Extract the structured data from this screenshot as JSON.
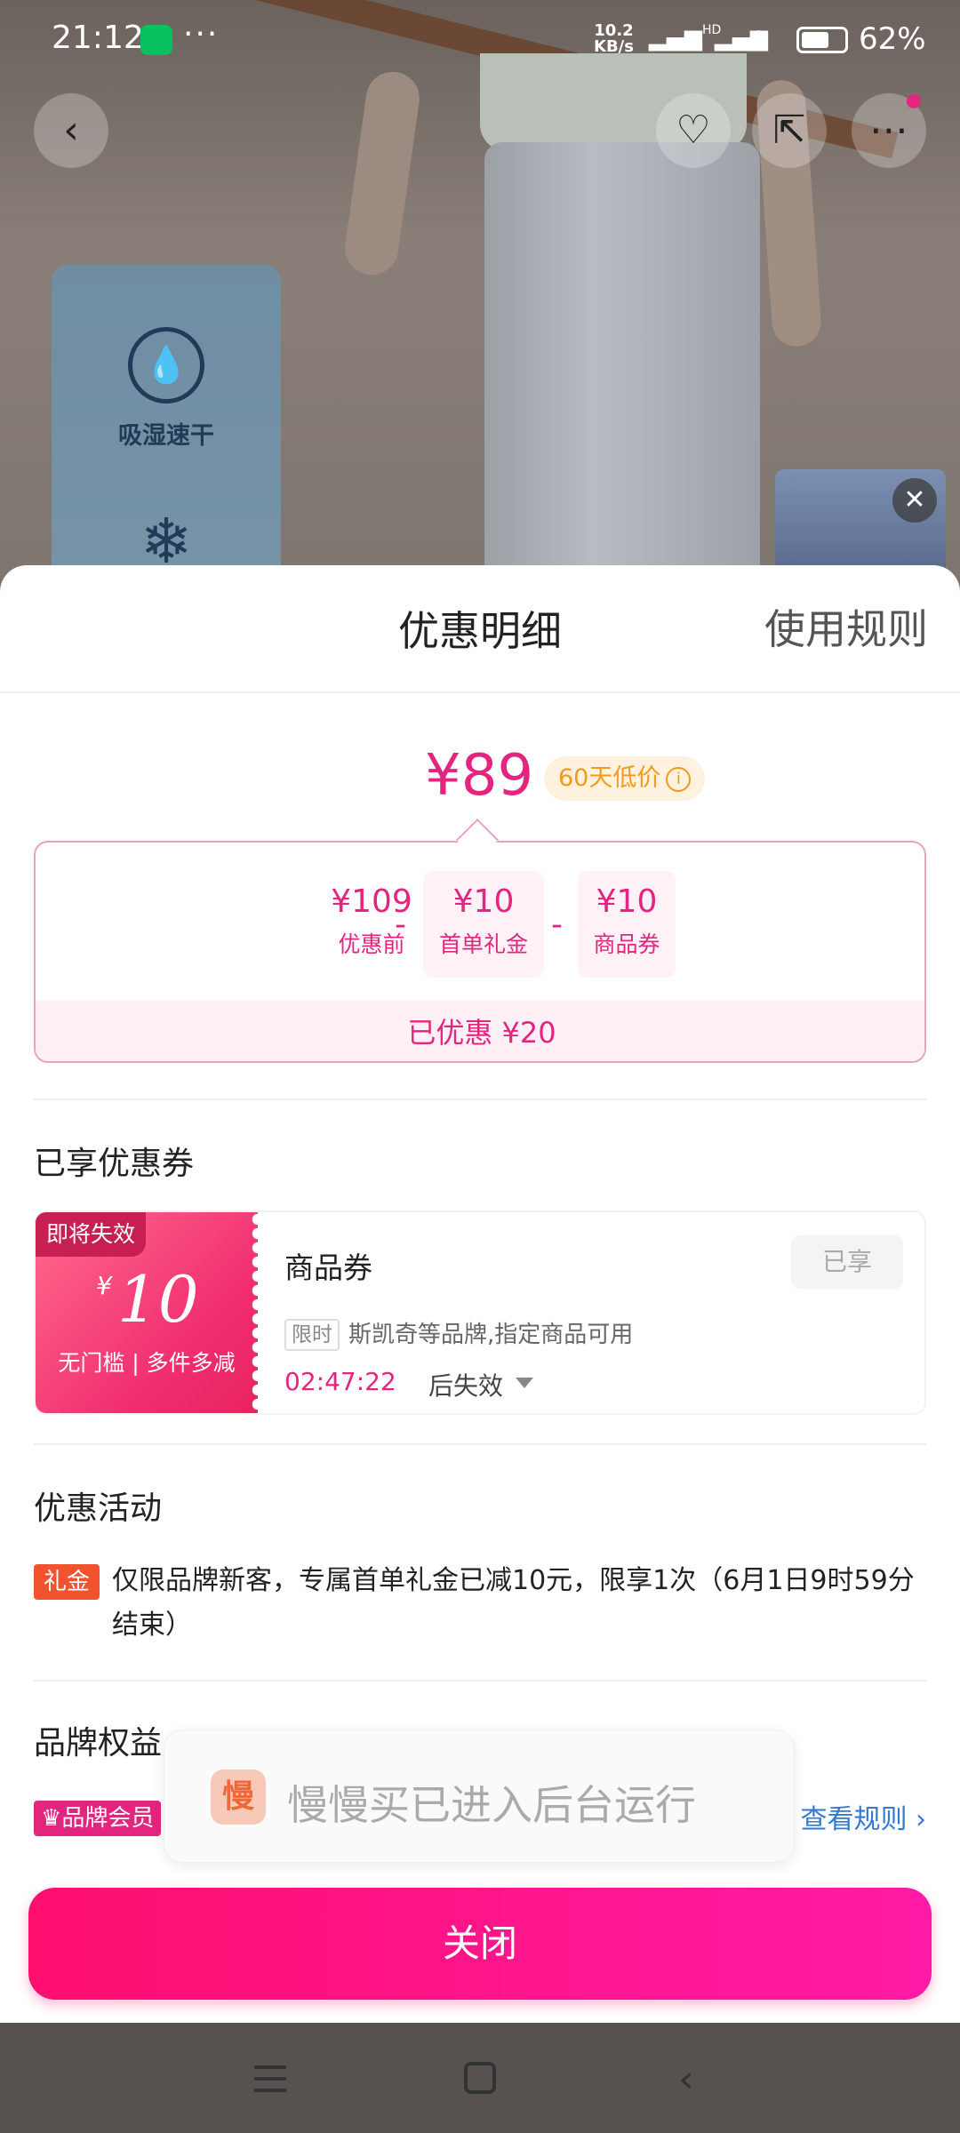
{
  "status_bar": {
    "time": "21:12",
    "more": "···",
    "net_speed_value": "10.2",
    "net_speed_unit": "KB/s",
    "sim1": "HD",
    "sim2": "HD",
    "battery_pct": "62%"
  },
  "product": {
    "feature_label": "吸湿速干"
  },
  "sheet": {
    "title": "优惠明细",
    "rules_link": "使用规则",
    "final_price": "¥89",
    "low_price_badge": "60天低价",
    "calc": {
      "items": [
        {
          "amount": "¥109",
          "label": "优惠前"
        },
        {
          "amount": "¥10",
          "label": "首单礼金"
        },
        {
          "amount": "¥10",
          "label": "商品券"
        }
      ],
      "op": "-",
      "saved": "已优惠 ¥20"
    },
    "coupons_section_title": "已享优惠券",
    "coupon": {
      "expire_tag": "即将失效",
      "currency": "¥",
      "value": "10",
      "desc": "无门槛 | 多件多减",
      "name": "商品券",
      "used_label": "已享",
      "limit_tag": "限时",
      "scope": "斯凯奇等品牌,指定商品可用",
      "timer": "02:47:22",
      "timer_suffix": "后失效"
    },
    "activity_section_title": "优惠活动",
    "activity": {
      "tag": "礼金",
      "text": "仅限品牌新客，专属首单礼金已减10元，限享1次（6月1日9时59分结束）"
    },
    "brand_section_title": "品牌权益",
    "brand_member_tag": "品牌会员",
    "brand_rules_link": "查看规则 ›",
    "close_button": "关闭"
  },
  "toast": {
    "app_icon_char": "慢",
    "message": "慢慢买已进入后台运行"
  },
  "icons": {
    "back": "‹",
    "favorite": "♡",
    "share": "⇱",
    "more": "⋯"
  },
  "colors": {
    "accent": "#e3257f",
    "close_btn_start": "#ff0f6e",
    "close_btn_end": "#ff1aa6",
    "link": "#2f7ad9",
    "low_badge": "#f39a1c"
  }
}
